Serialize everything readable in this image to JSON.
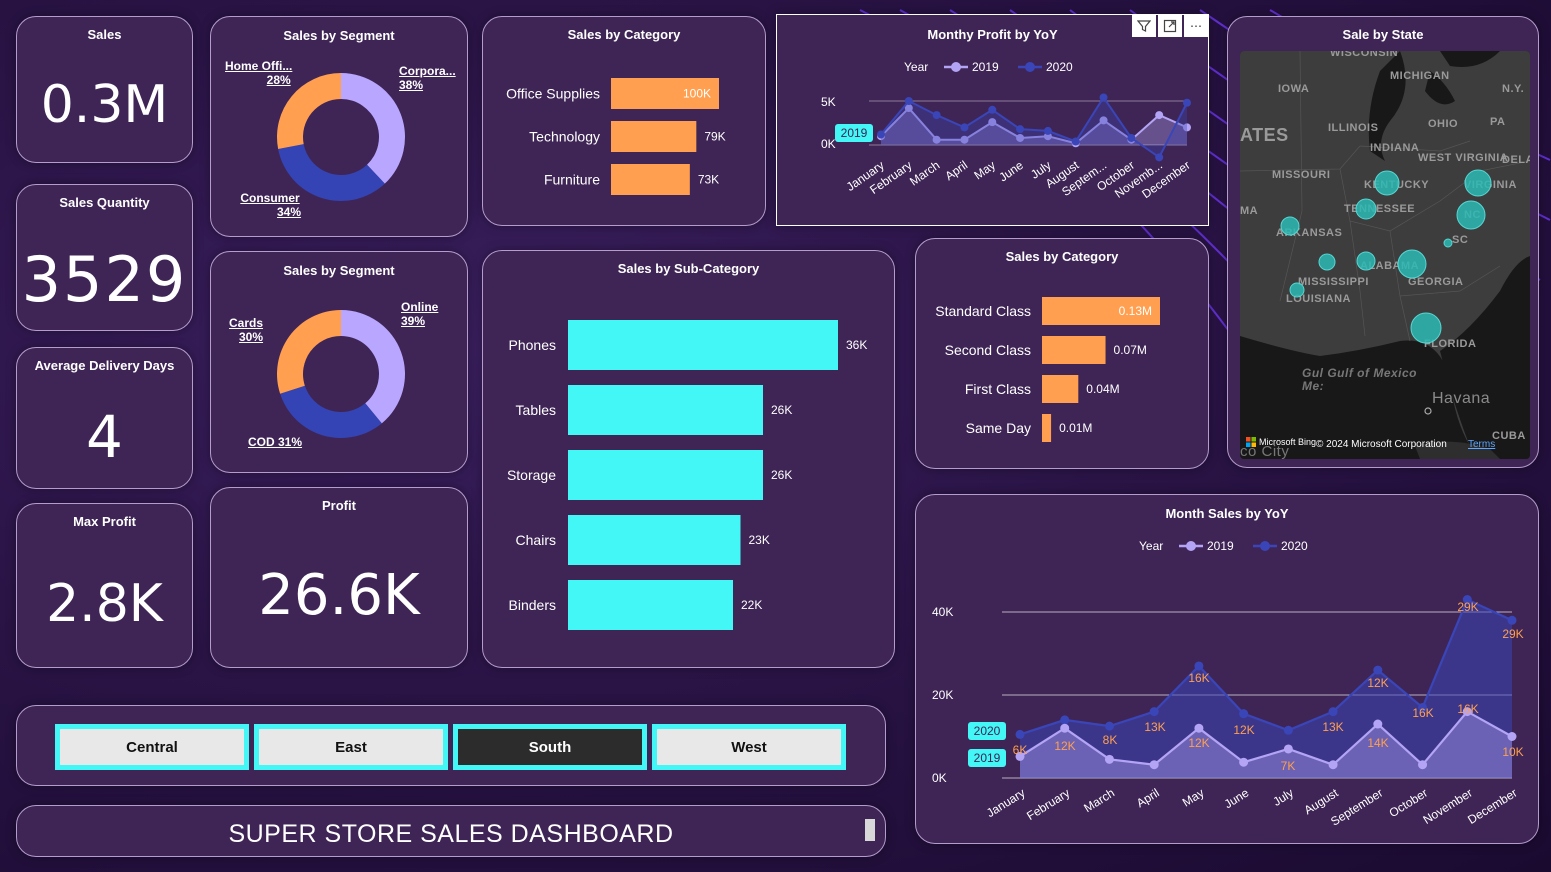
{
  "colors": {
    "card_bg": "#3f2555",
    "card_border": "#b49ccc",
    "orange": "#ff9f4f",
    "cyan": "#44f7f7",
    "lavender": "#b8a6ff",
    "navy": "#3444b5",
    "series_2019": "#b3a4f5",
    "series_2020": "#3a45b8"
  },
  "kpis": {
    "sales": {
      "title": "Sales",
      "value": "0.3M"
    },
    "quantity": {
      "title": "Sales Quantity",
      "value": "3529"
    },
    "delivery": {
      "title": "Average Delivery Days",
      "value": "4"
    },
    "max_profit": {
      "title": "Max Profit",
      "value": "2.8K"
    },
    "profit": {
      "title": "Profit",
      "value": "26.6K"
    }
  },
  "segment1": {
    "title": "Sales by Segment",
    "labels": [
      {
        "name": "Home Offi...",
        "pct": "28%"
      },
      {
        "name": "Corpora...",
        "pct": "38%"
      },
      {
        "name": "Consumer",
        "pct": "34%"
      }
    ]
  },
  "segment2": {
    "title": "Sales by Segment",
    "labels": [
      {
        "name": "Cards",
        "pct": "30%"
      },
      {
        "name": "Online",
        "pct": "39%"
      },
      {
        "name": "COD 31%"
      }
    ]
  },
  "category": {
    "title": "Sales by Category"
  },
  "subcategory": {
    "title": "Sales by Sub-Category"
  },
  "shipmode": {
    "title": "Sales by Category"
  },
  "monthly_profit": {
    "title": "Monthy Profit  by YoY",
    "legend_title": "Year",
    "badge": "2019",
    "icons": {
      "filter": "filter-icon",
      "focus": "focus-mode-icon",
      "more": "more-options-icon"
    }
  },
  "state_map": {
    "title": "Sale by State",
    "labels": [
      "WISCONSIN",
      "MICHIGAN",
      "IOWA",
      "N.Y.",
      "ILLINOIS",
      "OHIO",
      "PA",
      "ATES",
      "INDIANA",
      "WEST VIRGINIA",
      "DELA",
      "MISSOURI",
      "KENTUCKY",
      "VIRGINIA",
      "MA",
      "TENNESSEE",
      "NC",
      "ARKANSAS",
      "SC",
      "ALABAMA",
      "MISSISSIPPI",
      "GEORGIA",
      "LOUISIANA",
      "FLORIDA",
      "Gul Gulf of Mexico",
      "Me:",
      "Havana",
      "CUBA",
      "co City"
    ],
    "footer_bing": "Microsoft Bing",
    "footer_copyright": "© 2024 Microsoft Corporation",
    "footer_terms": "Terms"
  },
  "month_sales": {
    "title": "Month Sales by YoY",
    "legend_title": "Year",
    "badge_2020": "2020",
    "badge_2019": "2019"
  },
  "regions": {
    "items": [
      {
        "label": "Central",
        "active": false
      },
      {
        "label": "East",
        "active": false
      },
      {
        "label": "South",
        "active": true
      },
      {
        "label": "West",
        "active": false
      }
    ]
  },
  "footer": {
    "title": "SUPER STORE SALES DASHBOARD"
  },
  "chart_data": [
    {
      "id": "segment1",
      "type": "pie",
      "title": "Sales by Segment",
      "categories": [
        "Corpora...",
        "Consumer",
        "Home Offi..."
      ],
      "values": [
        38,
        34,
        28
      ],
      "colors": [
        "#b8a6ff",
        "#3444b5",
        "#ff9f4f"
      ]
    },
    {
      "id": "segment2",
      "type": "pie",
      "title": "Sales by Segment",
      "categories": [
        "Online",
        "COD",
        "Cards"
      ],
      "values": [
        39,
        31,
        30
      ],
      "colors": [
        "#b8a6ff",
        "#3444b5",
        "#ff9f4f"
      ]
    },
    {
      "id": "category",
      "type": "bar",
      "title": "Sales by Category",
      "categories": [
        "Office Supplies",
        "Technology",
        "Furniture"
      ],
      "values": [
        100,
        79,
        73
      ],
      "value_labels": [
        "100K",
        "79K",
        "73K"
      ],
      "xlim": [
        0,
        100
      ]
    },
    {
      "id": "subcategory",
      "type": "bar",
      "title": "Sales by Sub-Category",
      "categories": [
        "Phones",
        "Tables",
        "Storage",
        "Chairs",
        "Binders"
      ],
      "values": [
        36,
        26,
        26,
        23,
        22
      ],
      "value_labels": [
        "36K",
        "26K",
        "26K",
        "23K",
        "22K"
      ],
      "xlim": [
        0,
        36
      ]
    },
    {
      "id": "shipmode",
      "type": "bar",
      "title": "Sales by Category",
      "categories": [
        "Standard Class",
        "Second Class",
        "First Class",
        "Same Day"
      ],
      "values": [
        0.13,
        0.07,
        0.04,
        0.01
      ],
      "value_labels": [
        "0.13M",
        "0.07M",
        "0.04M",
        "0.01M"
      ],
      "xlim": [
        0,
        0.13
      ]
    },
    {
      "id": "monthly_profit",
      "type": "line",
      "title": "Monthy Profit  by YoY",
      "categories": [
        "January",
        "February",
        "March",
        "April",
        "May",
        "June",
        "July",
        "August",
        "Septem...",
        "October",
        "Novemb...",
        "December"
      ],
      "series": [
        {
          "name": "2019",
          "values": [
            1.0,
            4.2,
            0.6,
            0.6,
            2.6,
            0.8,
            1.0,
            0.2,
            2.8,
            0.6,
            3.4,
            2.0
          ]
        },
        {
          "name": "2020",
          "values": [
            1.2,
            5.0,
            3.4,
            2.0,
            4.0,
            1.8,
            1.6,
            0.4,
            5.4,
            0.8,
            -1.4,
            4.8
          ]
        }
      ],
      "yticks": [
        "5K",
        "0K"
      ],
      "ylim": [
        -2,
        5.5
      ],
      "legend": "top"
    },
    {
      "id": "month_sales",
      "type": "area",
      "title": "Month Sales by YoY",
      "categories": [
        "January",
        "February",
        "March",
        "April",
        "May",
        "June",
        "July",
        "August",
        "September",
        "October",
        "November",
        "December"
      ],
      "series": [
        {
          "name": "2019",
          "values": [
            5.2,
            12,
            4.5,
            3.2,
            12,
            3.8,
            7,
            3.2,
            13,
            3.2,
            16,
            10
          ]
        },
        {
          "name": "2020",
          "values": [
            10.5,
            14,
            12.5,
            16,
            27,
            15.5,
            11.5,
            16,
            26,
            17,
            43,
            38
          ]
        }
      ],
      "data_labels": [
        "6K",
        "12K",
        "8K",
        "13K",
        "16K",
        "12K",
        "12K",
        "7K",
        "13K",
        "12K",
        "14K",
        "16K",
        "16K",
        "29K",
        "29K",
        "10K"
      ],
      "yticks": [
        "40K",
        "20K",
        "0K"
      ],
      "ylim": [
        0,
        45
      ],
      "legend": "top"
    }
  ]
}
